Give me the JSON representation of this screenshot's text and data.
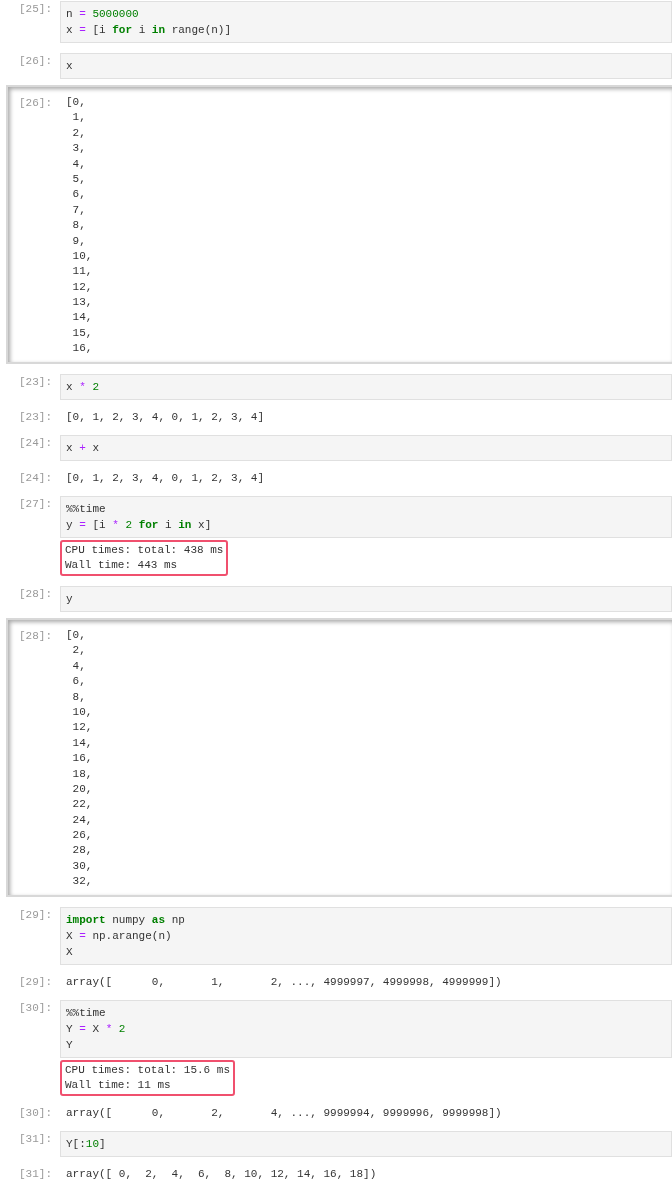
{
  "cells": [
    {
      "prompt": "[25]:",
      "code": [
        [
          {
            "text": "n ",
            "kind": "name"
          },
          {
            "text": "= ",
            "kind": "op"
          },
          {
            "text": "5000000",
            "kind": "num"
          }
        ],
        [
          {
            "text": "x ",
            "kind": "name"
          },
          {
            "text": "= ",
            "kind": "op"
          },
          {
            "text": "[i ",
            "kind": "name"
          },
          {
            "text": "for",
            "kind": "kw"
          },
          {
            "text": " i ",
            "kind": "name"
          },
          {
            "text": "in",
            "kind": "kw"
          },
          {
            "text": " range(n)]",
            "kind": "name"
          }
        ]
      ]
    },
    {
      "prompt": "[26]:",
      "code": [
        [
          {
            "text": "x",
            "kind": "name"
          }
        ]
      ],
      "outputs": [
        {
          "kind": "scrolled",
          "prompt": "[26]:",
          "lines": [
            "[0,",
            " 1,",
            " 2,",
            " 3,",
            " 4,",
            " 5,",
            " 6,",
            " 7,",
            " 8,",
            " 9,",
            " 10,",
            " 11,",
            " 12,",
            " 13,",
            " 14,",
            " 15,",
            " 16,"
          ]
        }
      ]
    },
    {
      "prompt": "[23]:",
      "code": [
        [
          {
            "text": "x ",
            "kind": "name"
          },
          {
            "text": "* ",
            "kind": "op"
          },
          {
            "text": "2",
            "kind": "num"
          }
        ]
      ],
      "outputs": [
        {
          "kind": "result",
          "prompt": "[23]:",
          "lines": [
            "[0, 1, 2, 3, 4, 0, 1, 2, 3, 4]"
          ]
        }
      ]
    },
    {
      "prompt": "[24]:",
      "code": [
        [
          {
            "text": "x ",
            "kind": "name"
          },
          {
            "text": "+",
            "kind": "op"
          },
          {
            "text": " x",
            "kind": "name"
          }
        ]
      ],
      "outputs": [
        {
          "kind": "result",
          "prompt": "[24]:",
          "lines": [
            "[0, 1, 2, 3, 4, 0, 1, 2, 3, 4]"
          ]
        }
      ]
    },
    {
      "prompt": "[27]:",
      "code": [
        [
          {
            "text": "%%time",
            "kind": "name"
          }
        ],
        [
          {
            "text": "y ",
            "kind": "name"
          },
          {
            "text": "=",
            "kind": "op"
          },
          {
            "text": " [i ",
            "kind": "name"
          },
          {
            "text": "* ",
            "kind": "op"
          },
          {
            "text": "2 ",
            "kind": "num"
          },
          {
            "text": "for",
            "kind": "kw"
          },
          {
            "text": " i ",
            "kind": "name"
          },
          {
            "text": "in",
            "kind": "kw"
          },
          {
            "text": " x]",
            "kind": "name"
          }
        ]
      ],
      "outputs": [
        {
          "kind": "stream",
          "highlighted": true,
          "lines": [
            "CPU times: total: 438 ms",
            "Wall time: 443 ms"
          ]
        }
      ]
    },
    {
      "prompt": "[28]:",
      "code": [
        [
          {
            "text": "y",
            "kind": "name"
          }
        ]
      ],
      "outputs": [
        {
          "kind": "scrolled",
          "prompt": "[28]:",
          "lines": [
            "[0,",
            " 2,",
            " 4,",
            " 6,",
            " 8,",
            " 10,",
            " 12,",
            " 14,",
            " 16,",
            " 18,",
            " 20,",
            " 22,",
            " 24,",
            " 26,",
            " 28,",
            " 30,",
            " 32,"
          ]
        }
      ]
    },
    {
      "prompt": "[29]:",
      "code": [
        [
          {
            "text": "import",
            "kind": "kw"
          },
          {
            "text": " numpy ",
            "kind": "name"
          },
          {
            "text": "as",
            "kind": "kw"
          },
          {
            "text": " np",
            "kind": "name"
          }
        ],
        [
          {
            "text": "X ",
            "kind": "name"
          },
          {
            "text": "=",
            "kind": "op"
          },
          {
            "text": " np.arange(n)",
            "kind": "name"
          }
        ],
        [
          {
            "text": "X",
            "kind": "name"
          }
        ]
      ],
      "outputs": [
        {
          "kind": "result",
          "prompt": "[29]:",
          "lines": [
            "array([      0,       1,       2, ..., 4999997, 4999998, 4999999])"
          ]
        }
      ]
    },
    {
      "prompt": "[30]:",
      "code": [
        [
          {
            "text": "%%time",
            "kind": "name"
          }
        ],
        [
          {
            "text": "Y ",
            "kind": "name"
          },
          {
            "text": "=",
            "kind": "op"
          },
          {
            "text": " X ",
            "kind": "name"
          },
          {
            "text": "* ",
            "kind": "op"
          },
          {
            "text": "2",
            "kind": "num"
          }
        ],
        [
          {
            "text": "Y",
            "kind": "name"
          }
        ]
      ],
      "outputs": [
        {
          "kind": "stream",
          "highlighted": true,
          "lines": [
            "CPU times: total: 15.6 ms",
            "Wall time: 11 ms"
          ]
        },
        {
          "kind": "result",
          "prompt": "[30]:",
          "lines": [
            "array([      0,       2,       4, ..., 9999994, 9999996, 9999998])"
          ]
        }
      ]
    },
    {
      "prompt": "[31]:",
      "code": [
        [
          {
            "text": "Y[:",
            "kind": "name"
          },
          {
            "text": "10",
            "kind": "num"
          },
          {
            "text": "]",
            "kind": "name"
          }
        ]
      ],
      "outputs": [
        {
          "kind": "result",
          "prompt": "[31]:",
          "lines": [
            "array([ 0,  2,  4,  6,  8, 10, 12, 14, 16, 18])"
          ]
        }
      ]
    }
  ]
}
